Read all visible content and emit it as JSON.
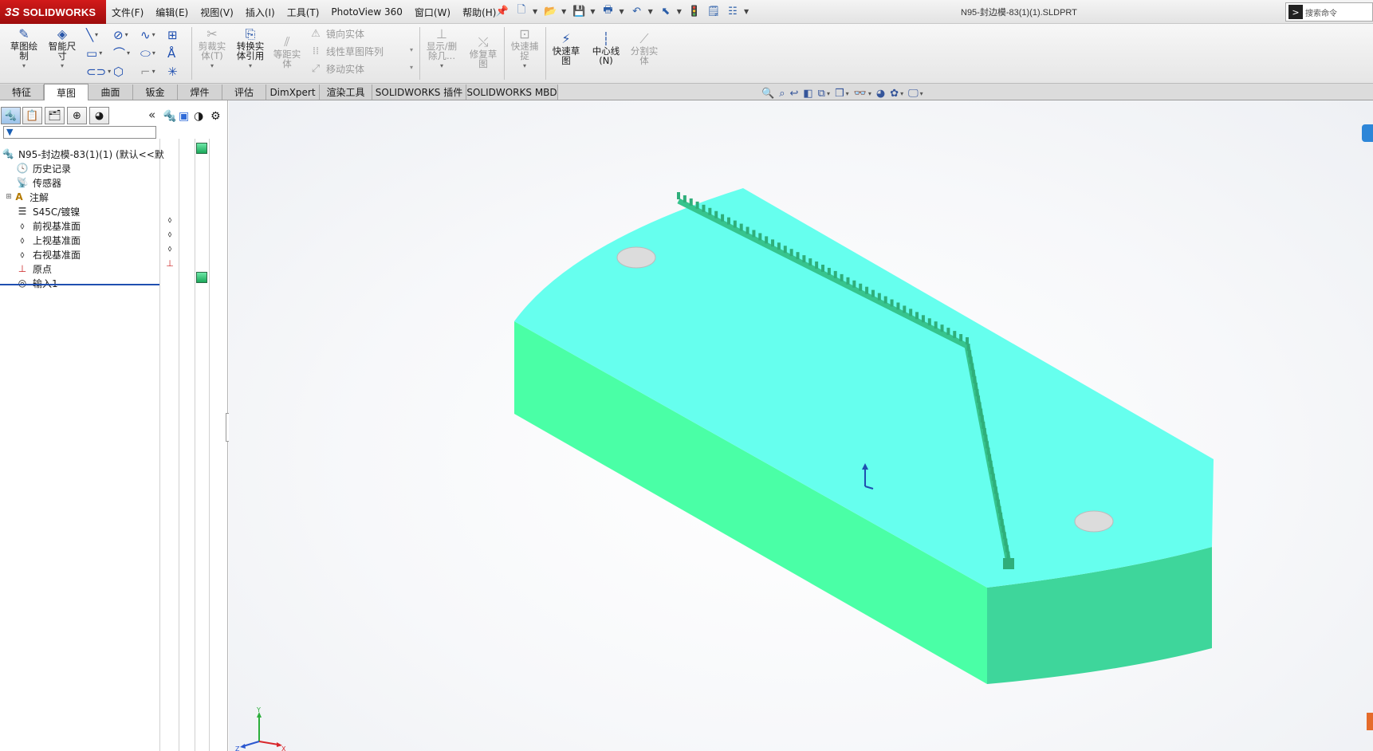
{
  "app": {
    "logo_ds": "3S",
    "logo_text": "SOLIDWORKS",
    "document_title": "N95-封边模-83(1)(1).SLDPRT",
    "search_placeholder": "搜索命令"
  },
  "menu": [
    "文件(F)",
    "编辑(E)",
    "视图(V)",
    "插入(I)",
    "工具(T)",
    "PhotoView 360",
    "窗口(W)",
    "帮助(H)"
  ],
  "quick_access_icons": [
    "pin-icon",
    "new-document-icon",
    "open-icon",
    "save-icon",
    "print-icon",
    "undo-icon",
    "select-icon",
    "rebuild-icon",
    "file-properties-icon",
    "options-icon"
  ],
  "command_manager": {
    "sketch": "草图绘\n制",
    "smart_dimension": "智能尺\n寸",
    "trim_entities": "剪裁实\n体(T)",
    "convert_entities": "转换实\n体引用",
    "offset_entities": "等距实\n体",
    "mirror_entities": "镜向实体",
    "linear_pattern": "线性草图阵列",
    "move_entities": "移动实体",
    "display_delete": "显示/删\n除几...",
    "repair_sketch": "修复草\n图",
    "quick_snaps": "快速捕\n捉",
    "rapid_sketch": "快速草\n图",
    "centerline": "中心线\n(N)",
    "split_entities": "分割实\n体"
  },
  "tabs": [
    {
      "label": "特征",
      "active": false
    },
    {
      "label": "草图",
      "active": true
    },
    {
      "label": "曲面",
      "active": false
    },
    {
      "label": "钣金",
      "active": false
    },
    {
      "label": "焊件",
      "active": false
    },
    {
      "label": "评估",
      "active": false
    },
    {
      "label": "DimXpert",
      "active": false
    },
    {
      "label": "渲染工具",
      "active": false
    },
    {
      "label": "SOLIDWORKS 插件",
      "active": false
    },
    {
      "label": "SOLIDWORKS MBD",
      "active": false
    }
  ],
  "feature_tree": {
    "collapse_symbol": "«",
    "items": [
      {
        "label": "N95-封边模-83(1)(1)  (默认<<默",
        "icon": "part-icon"
      },
      {
        "label": "历史记录",
        "icon": "history-icon"
      },
      {
        "label": "传感器",
        "icon": "sensors-icon"
      },
      {
        "label": "注解",
        "icon": "annotations-icon"
      },
      {
        "label": "S45C/镀镍",
        "icon": "material-icon"
      },
      {
        "label": "前视基准面",
        "icon": "plane-icon"
      },
      {
        "label": "上视基准面",
        "icon": "plane-icon"
      },
      {
        "label": "右视基准面",
        "icon": "plane-icon"
      },
      {
        "label": "原点",
        "icon": "origin-icon"
      },
      {
        "label": "输入1",
        "icon": "imported-body-icon"
      }
    ]
  },
  "viewport": {
    "heads_up_icons": [
      "zoom-to-fit-icon",
      "zoom-area-icon",
      "previous-view-icon",
      "section-view-icon",
      "view-orientation-icon",
      "display-style-icon",
      "hide-show-icon",
      "appearance-icon",
      "scene-icon",
      "view-settings-icon"
    ],
    "model_top_color": "#66FFEE",
    "model_side_color": "#4AFFA6",
    "model_end_color": "#3ED69B",
    "triad_labels": [
      "Y",
      "X",
      "Z"
    ]
  }
}
